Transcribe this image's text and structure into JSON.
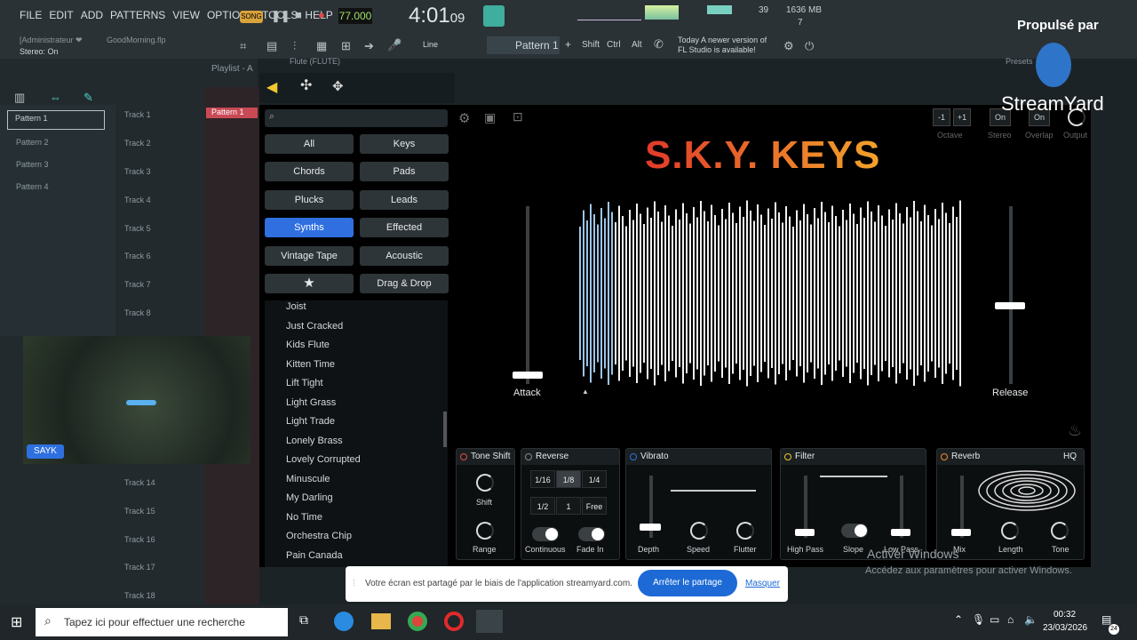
{
  "menubar": {
    "items": [
      "FILE",
      "EDIT",
      "ADD",
      "PATTERNS",
      "VIEW",
      "OPTIONS",
      "TOOLS",
      "HELP"
    ],
    "song_badge": "SONG",
    "tempo": "77.000",
    "time_main": "4:01",
    "time_sub": "09",
    "cpu": "39",
    "memory": "1636 MB",
    "voices": "7"
  },
  "toolbar": {
    "user": "[Administrateur ❤",
    "project": "GoodMorning.flp",
    "stereo": "Stereo: On",
    "line": "Line",
    "pattern": "Pattern 1",
    "shift": "Shift",
    "ctrl": "Ctrl",
    "alt": "Alt",
    "news_date": "Today",
    "news": "A newer version of FL Studio is available!",
    "playlist": "Playlist - A"
  },
  "patterns": [
    "Pattern 1",
    "Pattern 2",
    "Pattern 3",
    "Pattern 4"
  ],
  "tracks": [
    "Track 1",
    "Track 2",
    "Track 3",
    "Track 4",
    "Track 5",
    "Track 6",
    "Track 7",
    "Track 8",
    "Track 14",
    "Track 15",
    "Track 16",
    "Track 17",
    "Track 18"
  ],
  "clip": "Pattern 1",
  "plugin": {
    "title": "Flute (FLUTE)",
    "presets": "Presets",
    "brand": "S.K.Y. KEYS",
    "categories": [
      "All",
      "Keys",
      "Chords",
      "Pads",
      "Plucks",
      "Leads",
      "Synths",
      "Effected",
      "Vintage Tape",
      "Acoustic",
      "★",
      "Drag & Drop"
    ],
    "selected_category": "Synths",
    "presets_list": [
      "Joist",
      "Just Cracked",
      "Kids Flute",
      "Kitten Time",
      "Lift Tight",
      "Light Grass",
      "Light Trade",
      "Lonely Brass",
      "Lovely Corrupted",
      "Minuscule",
      "My Darling",
      "No Time",
      "Orchestra Chip",
      "Pain Canada"
    ],
    "attack": "Attack",
    "release": "Release",
    "attack_level": 0.05,
    "release_level": 0.44,
    "top_controls": {
      "octave_minus": "-1",
      "octave_plus": "+1",
      "octave": "Octave",
      "stereo_val": "On",
      "stereo": "Stereo",
      "overlap_val": "On",
      "overlap": "Overlap",
      "output": "Output"
    },
    "tone_shift": {
      "title": "Tone Shift",
      "shift": "Shift",
      "range": "Range"
    },
    "reverse": {
      "title": "Reverse",
      "cells": [
        "1/16",
        "1/8",
        "1/4",
        "1/2",
        "1",
        "Free"
      ],
      "selected": "1/8",
      "continuous": "Continuous",
      "fade_in": "Fade In"
    },
    "vibrato": {
      "title": "Vibrato",
      "depth": "Depth",
      "speed": "Speed",
      "flutter": "Flutter"
    },
    "filter": {
      "title": "Filter",
      "high_pass": "High Pass",
      "slope": "Slope",
      "low_pass": "Low Pass"
    },
    "reverb": {
      "title": "Reverb",
      "hq": "HQ",
      "mix": "Mix",
      "length": "Length",
      "tone": "Tone"
    }
  },
  "stream": {
    "propulse": "Propulsé par",
    "logo": "StreamYard",
    "name": "SAYK",
    "share_text": "Votre écran est partagé par le biais de l'application streamyard.com.",
    "stop": "Arrêter le partage",
    "hide": "Masquer"
  },
  "windows": {
    "activate": "Activer Windows",
    "activate_sub": "Accédez aux paramètres pour activer Windows.",
    "search": "Tapez ici pour effectuer une recherche",
    "time": "00:32",
    "date": "23/03/2026",
    "notif": "24"
  },
  "colors": {
    "accent": "#2f6fe0",
    "brand_start": "#e23a2a",
    "brand_end": "#f2a32a"
  }
}
